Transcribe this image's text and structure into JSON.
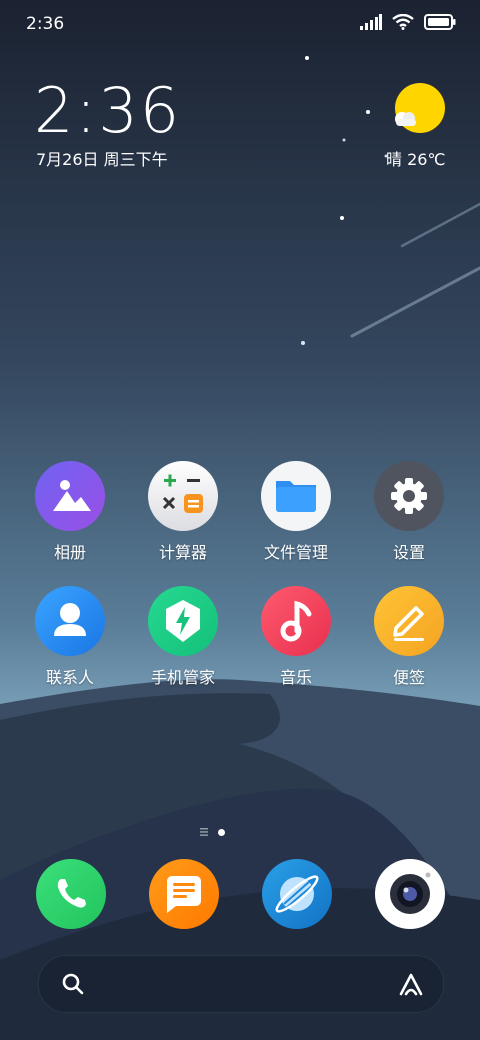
{
  "status": {
    "time": "2:36"
  },
  "clock": {
    "time": "2:36",
    "date": "7月26日 周三下午"
  },
  "weather": {
    "text": "晴 26℃"
  },
  "apps": [
    {
      "label": "相册",
      "icon": "gallery-icon"
    },
    {
      "label": "计算器",
      "icon": "calculator-icon"
    },
    {
      "label": "文件管理",
      "icon": "folder-icon"
    },
    {
      "label": "设置",
      "icon": "gear-icon"
    },
    {
      "label": "联系人",
      "icon": "contact-icon"
    },
    {
      "label": "手机管家",
      "icon": "security-shield-icon"
    },
    {
      "label": "音乐",
      "icon": "music-note-icon"
    },
    {
      "label": "便签",
      "icon": "notes-pencil-icon"
    }
  ],
  "dock": [
    {
      "icon": "phone-icon"
    },
    {
      "icon": "message-icon"
    },
    {
      "icon": "browser-planet-icon"
    },
    {
      "icon": "camera-icon"
    }
  ],
  "search": {
    "placeholder": ""
  },
  "colors": {
    "gallery": "#7a5cf0",
    "folder": "#2e8ff0",
    "settings": "#505560",
    "contacts": "#2a8cf0",
    "security": "#1ecf8a",
    "music": "#f0435f",
    "notes": "#f8b330",
    "phone": "#2bd36b",
    "message": "#ff8a10",
    "browser": "#1f8ad8",
    "sun": "#ffd500"
  }
}
